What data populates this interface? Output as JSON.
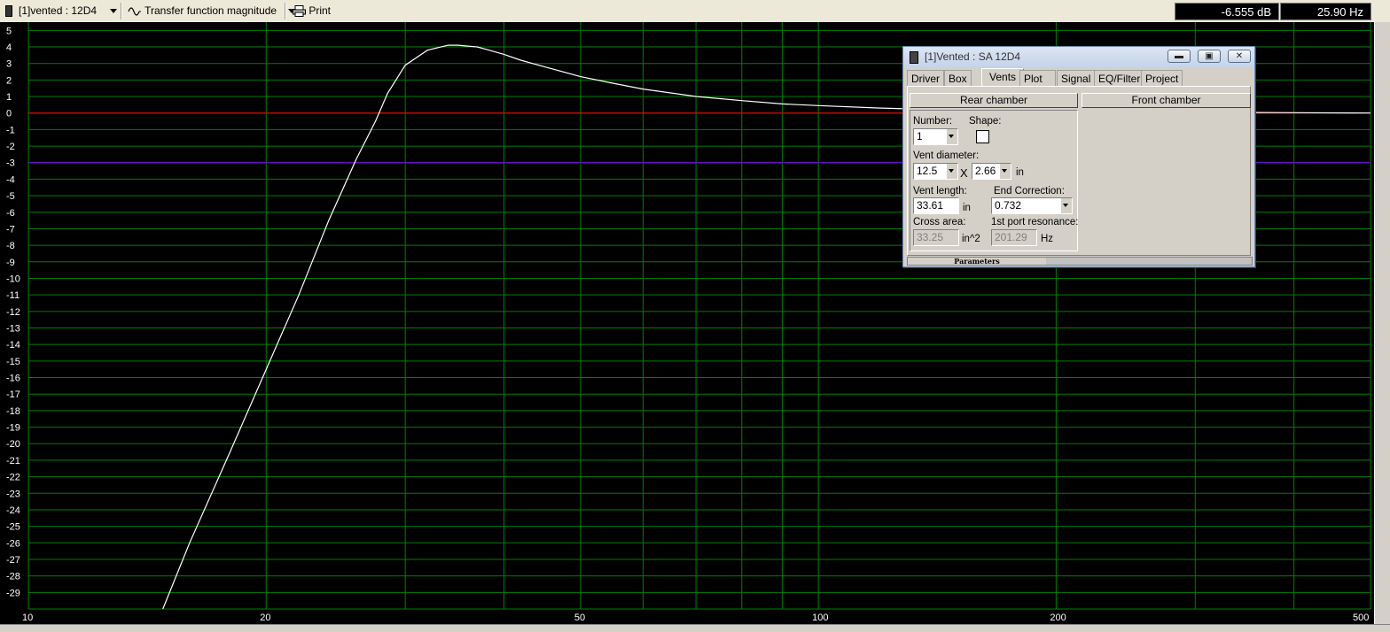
{
  "toolbar": {
    "project_label": "[1]vented : 12D4",
    "view_label": "Transfer function magnitude",
    "print_label": "Print",
    "readout_db": "-6.555 dB",
    "readout_hz": "25.90 Hz"
  },
  "dialog": {
    "title": "[1]Vented : SA 12D4",
    "tabs": [
      "Driver",
      "Box",
      "Vents",
      "Plot",
      "Signal",
      "EQ/Filter",
      "Project"
    ],
    "active_tab": "Vents",
    "rear_chamber_label": "Rear chamber",
    "front_chamber_label": "Front chamber",
    "number_label": "Number:",
    "number_value": "1",
    "shape_label": "Shape:",
    "vent_diameter_label": "Vent diameter:",
    "vent_diameter_value": "12.5",
    "times_symbol": "X",
    "vent_diameter_value2": "2.66",
    "unit_in": "in",
    "vent_length_label": "Vent length:",
    "vent_length_value": "33.61",
    "end_correction_label": "End Correction:",
    "end_correction_value": "0.732",
    "cross_area_label": "Cross area:",
    "cross_area_value": "33.25",
    "cross_area_unit": "in^2",
    "port_resonance_label": "1st port resonance:",
    "port_resonance_value": "201.29",
    "port_resonance_unit": "Hz",
    "status_label": "Parameters"
  },
  "chart_data": {
    "type": "line",
    "x_scale": "log",
    "xlim": [
      10,
      500
    ],
    "ylim": [
      -30,
      5.5
    ],
    "x_tick_labels": [
      "10",
      "20",
      "50",
      "100",
      "200",
      "500"
    ],
    "y_tick_labels": [
      "5",
      "4",
      "3",
      "2",
      "1",
      "0",
      "-1",
      "-2",
      "-3",
      "-4",
      "-5",
      "-6",
      "-7",
      "-8",
      "-9",
      "-10",
      "-11",
      "-12",
      "-13",
      "-14",
      "-15",
      "-16",
      "-17",
      "-18",
      "-19",
      "-20",
      "-21",
      "-22",
      "-23",
      "-24",
      "-25",
      "-26",
      "-27",
      "-28",
      "-29"
    ],
    "reference_lines": [
      {
        "y": 0,
        "color": "#ff0000"
      },
      {
        "y": -3,
        "color": "#8000ff"
      }
    ],
    "series": [
      {
        "color": "#ffffff",
        "x": [
          14.8,
          16,
          18,
          20,
          22,
          24,
          26,
          27.5,
          28.5,
          30,
          32,
          34,
          35,
          36,
          37,
          38,
          40,
          42,
          45,
          50,
          55,
          60,
          70,
          80,
          90,
          100,
          120,
          150,
          200,
          300,
          400,
          500
        ],
        "y": [
          -30,
          -26,
          -20.5,
          -15.5,
          -11,
          -6.5,
          -2.8,
          -0.5,
          1.2,
          2.9,
          3.8,
          4.1,
          4.1,
          4.05,
          4.0,
          3.85,
          3.55,
          3.2,
          2.8,
          2.2,
          1.8,
          1.45,
          1.0,
          0.75,
          0.55,
          0.45,
          0.3,
          0.18,
          0.1,
          0.05,
          0.02,
          0.0
        ]
      }
    ],
    "grid": true,
    "grid_color": "#008000",
    "background": "#000000"
  },
  "colors": {
    "window_bg": "#d4d0c8",
    "graph_bg": "#000000",
    "grid": "#008000",
    "curve": "#ffffff"
  }
}
